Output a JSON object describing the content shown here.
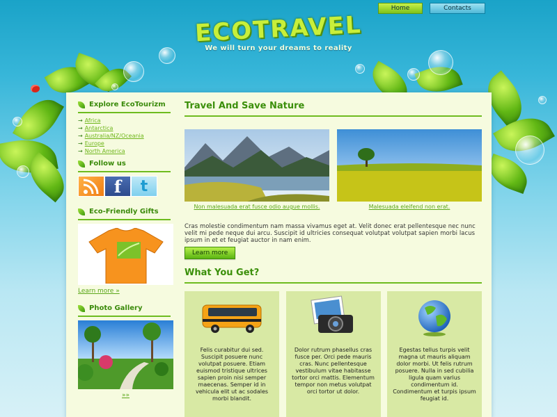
{
  "nav": {
    "home": "Home",
    "contacts": "Contacts"
  },
  "brand": {
    "logo": "ECOTRAVEL",
    "tagline": "We will turn your dreams to reality"
  },
  "sidebar": {
    "explore": {
      "title": "Explore EcoTourizm",
      "items": [
        "Africa",
        "Antarctica",
        "Australia/NZ/Oceania",
        "Europe",
        "North America"
      ]
    },
    "follow": {
      "title": "Follow us",
      "icons": [
        "rss-icon",
        "facebook-icon",
        "twitter-icon"
      ]
    },
    "gifts": {
      "title": "Eco-Friendly Gifts",
      "link": "Learn more »"
    },
    "gallery": {
      "title": "Photo Gallery",
      "link": "»»"
    }
  },
  "main": {
    "title": "Travel And Save Nature",
    "captions": [
      "Non malesuada erat fusce odio augue mollis.",
      "Malesuada eleifend non erat."
    ],
    "paragraph": "Cras molestie condimentum nam massa vivamus eget at. Velit donec erat pellentesque nec nunc velit mi pede neque dui arcu. Suscipit id ultricies consequat volutpat volutpat sapien morbi lacus ipsum in et et feugiat auctor in nam enim.",
    "learn_more": "Learn more",
    "section_title": "What You Get?",
    "features": [
      {
        "icon": "bus-icon",
        "text": "Felis curabitur dui sed. Suscipit posuere nunc volutpat posuere. Etiam euismod tristique ultrices sapien proin nisi semper maecenas. Semper id in vehicula elit ut ac sodales morbi blandit."
      },
      {
        "icon": "camera-icon",
        "text": "Dolor rutrum phasellus cras fusce per. Orci pede mauris cras. Nunc pellentesque vestibulum vitae habitasse tortor orci mattis. Elementum tempor non metus volutpat orci tortor ut dolor."
      },
      {
        "icon": "globe-icon",
        "text": "Egestas tellus turpis velit magna ut mauris aliquam dolor morbi. Ut felis rutrum posuere. Nulla in sed cubilia ligula quam varius condimentum id. Condimentum et turpis ipsum feugiat id."
      }
    ]
  },
  "colors": {
    "accent": "#6dbb1e",
    "heading": "#3b8f0a",
    "panel": "#f6fbdf",
    "feature_bg": "#d8e9a4"
  }
}
